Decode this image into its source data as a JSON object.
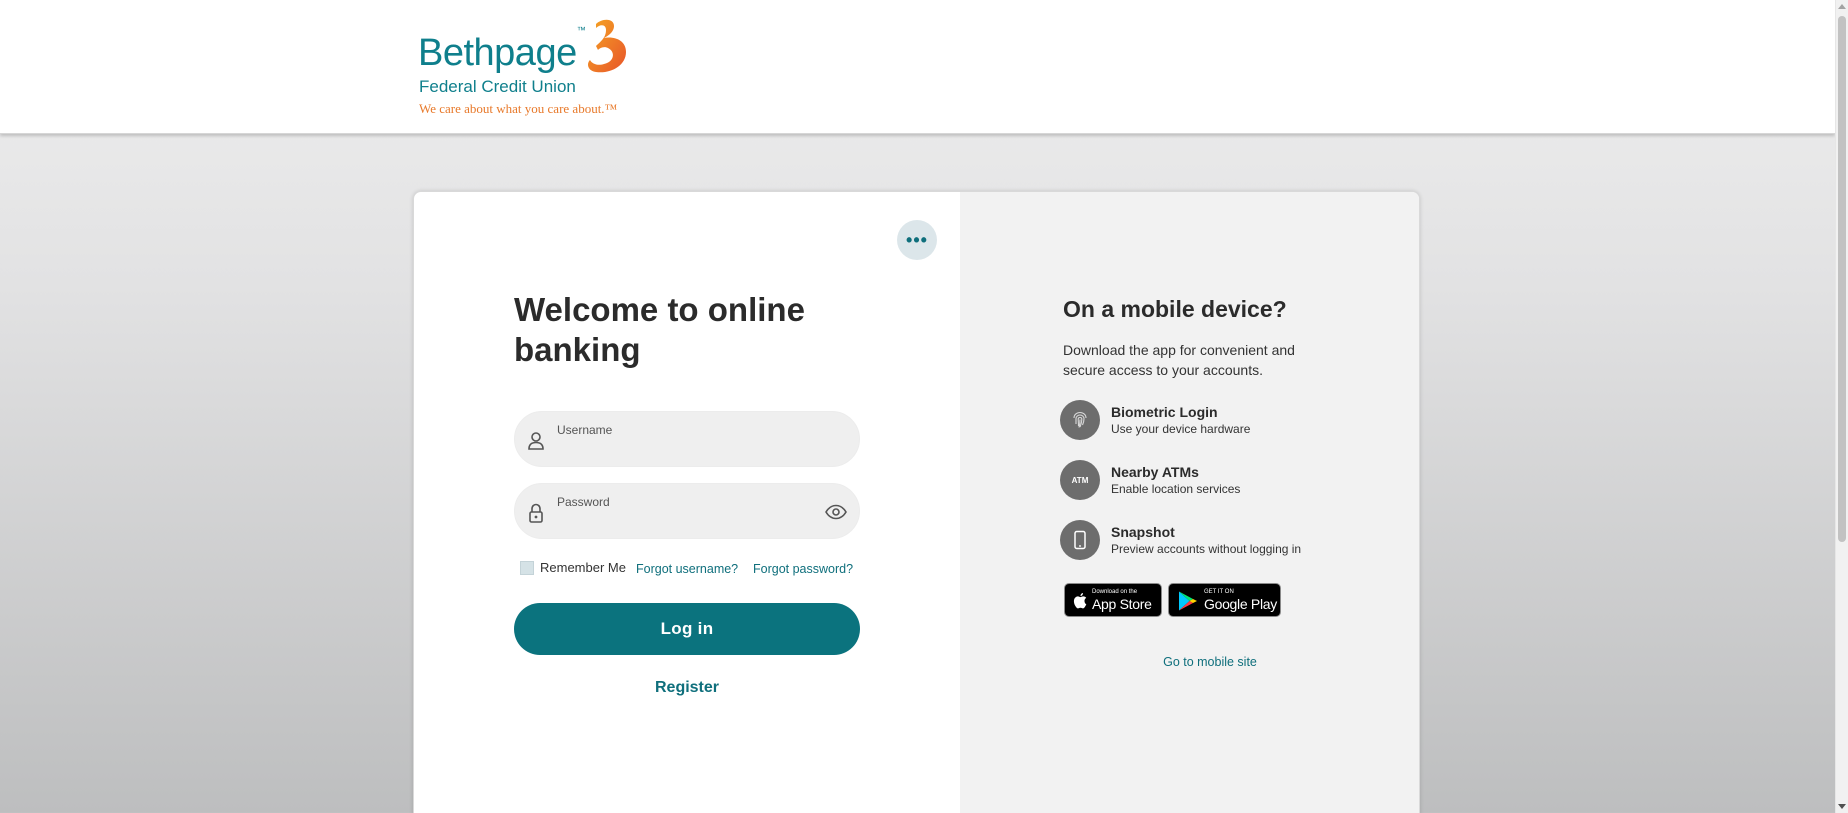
{
  "brand": {
    "name": "Bethpage",
    "trademark": "™",
    "subtitle": "Federal Credit Union",
    "tagline": "We care about what you care about.™"
  },
  "colors": {
    "accent": "#0b737e",
    "brand_teal": "#0f7f8c",
    "brand_orange": "#e8792a"
  },
  "login": {
    "more_button_label": "•••",
    "heading": "Welcome to online banking",
    "username": {
      "label": "Username",
      "value": "",
      "icon": "user-icon"
    },
    "password": {
      "label": "Password",
      "value": "",
      "icon": "lock-icon",
      "toggle_icon": "eye-icon"
    },
    "remember_me": {
      "label": "Remember Me",
      "checked": false
    },
    "forgot_username": "Forgot username?",
    "forgot_password": "Forgot password?",
    "login_button": "Log in",
    "register_link": "Register"
  },
  "mobile": {
    "title": "On a mobile device?",
    "description": "Download the app for convenient and secure access to your accounts.",
    "features": [
      {
        "icon": "fingerprint-icon",
        "title": "Biometric Login",
        "description": "Use your device hardware"
      },
      {
        "icon": "atm-icon",
        "icon_text": "ATM",
        "title": "Nearby ATMs",
        "description": "Enable location services"
      },
      {
        "icon": "phone-icon",
        "title": "Snapshot",
        "description": "Preview accounts without logging in"
      }
    ],
    "app_store": {
      "small": "Download on the",
      "big": "App Store"
    },
    "google_play": {
      "small": "GET IT ON",
      "big": "Google Play"
    },
    "mobile_site_link": "Go to mobile site"
  }
}
